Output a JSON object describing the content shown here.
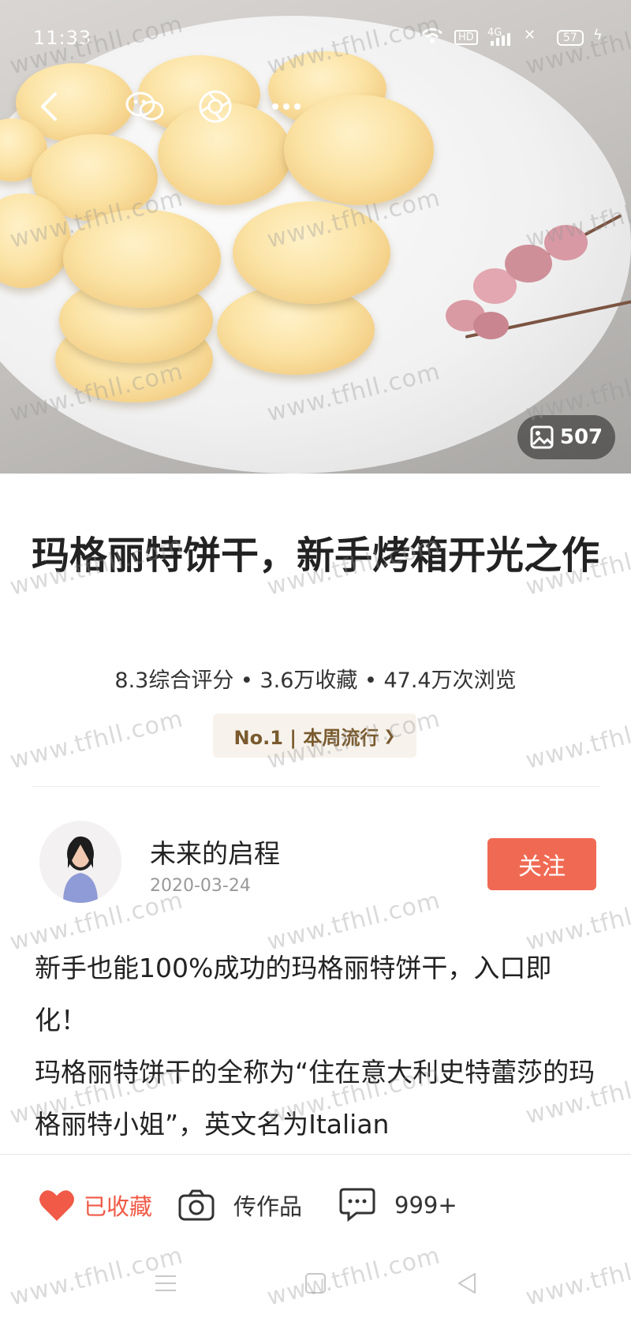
{
  "status_bar": {
    "time": "11:33",
    "network_label": "HD",
    "cell_label": "4G",
    "battery": "57"
  },
  "hero": {
    "photo_count": "507"
  },
  "recipe": {
    "title": "玛格丽特饼干，新手烤箱开光之作",
    "stats": "8.3综合评分 • 3.6万收藏 • 47.4万次浏览",
    "rank_label": "No.1 | 本周流行",
    "rank_arrow": "❯"
  },
  "author": {
    "name": "未来的启程",
    "date": "2020-03-24",
    "follow_label": "关注"
  },
  "description": {
    "line1": "新手也能100%成功的玛格丽特饼干，入口即化！",
    "line2": "玛格丽特饼干的全称为“住在意大利史特蕾莎的玛格丽特小姐”，英文名为Italian"
  },
  "actions": {
    "favorited_label": "已收藏",
    "upload_label": "传作品",
    "comments_label": "999+"
  },
  "watermark": "www.tfhll.com",
  "colors": {
    "accent": "#f06a53",
    "heart": "#f05a47",
    "rank_text": "#7a5a2e",
    "rank_bg": "#f7f3ec"
  },
  "icons": [
    "back-icon",
    "wechat-icon",
    "moments-icon",
    "gallery-icon",
    "heart-icon",
    "camera-icon",
    "comment-icon",
    "menu-nav-icon",
    "home-nav-icon",
    "back-nav-icon"
  ]
}
